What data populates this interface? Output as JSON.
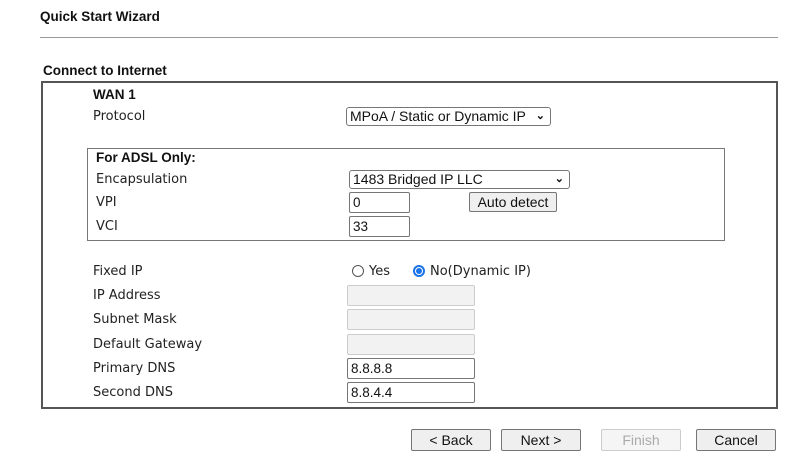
{
  "header": {
    "title": "Quick Start Wizard",
    "section": "Connect to Internet"
  },
  "wan": {
    "title": "WAN 1",
    "protocol_label": "Protocol",
    "protocol_value": "MPoA / Static or Dynamic IP"
  },
  "adsl": {
    "title": "For ADSL Only:",
    "encapsulation_label": "Encapsulation",
    "encapsulation_value": "1483 Bridged IP LLC",
    "vpi_label": "VPI",
    "vpi_value": "0",
    "vci_label": "VCI",
    "vci_value": "33",
    "auto_detect": "Auto detect"
  },
  "ip": {
    "fixed_ip_label": "Fixed IP",
    "yes_label": "Yes",
    "no_label": "No(Dynamic IP)",
    "selected": "No(Dynamic IP)",
    "ip_address_label": "IP Address",
    "subnet_mask_label": "Subnet Mask",
    "gateway_label": "Default Gateway",
    "primary_dns_label": "Primary DNS",
    "primary_dns_value": "8.8.8.8",
    "second_dns_label": "Second DNS",
    "second_dns_value": "8.8.4.4"
  },
  "buttons": {
    "back": "< Back",
    "next": "Next >",
    "finish": "Finish",
    "cancel": "Cancel"
  }
}
